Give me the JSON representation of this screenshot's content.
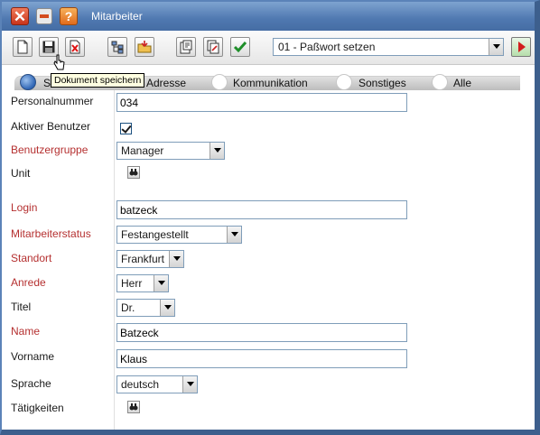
{
  "window": {
    "title": "Mitarbeiter"
  },
  "toolbar": {
    "action_select_value": "01 - Paßwort setzen",
    "tooltip": "Dokument speichern"
  },
  "tabs": [
    {
      "label": "S"
    },
    {
      "label": "Adresse"
    },
    {
      "label": "Kommunikation"
    },
    {
      "label": "Sonstiges"
    },
    {
      "label": "Alle"
    }
  ],
  "form": {
    "personalnummer": {
      "label": "Personalnummer",
      "value": "034"
    },
    "aktiver_benutzer": {
      "label": "Aktiver Benutzer",
      "checked": true
    },
    "benutzergruppe": {
      "label": "Benutzergruppe",
      "value": "Manager"
    },
    "unit": {
      "label": "Unit"
    },
    "login": {
      "label": "Login",
      "value": "batzeck"
    },
    "mitarbeiterstatus": {
      "label": "Mitarbeiterstatus",
      "value": "Festangestellt"
    },
    "standort": {
      "label": "Standort",
      "value": "Frankfurt"
    },
    "anrede": {
      "label": "Anrede",
      "value": "Herr"
    },
    "titel": {
      "label": "Titel",
      "value": "Dr."
    },
    "name": {
      "label": "Name",
      "value": "Batzeck"
    },
    "vorname": {
      "label": "Vorname",
      "value": "Klaus"
    },
    "sprache": {
      "label": "Sprache",
      "value": "deutsch"
    },
    "taetigkeiten": {
      "label": "Tätigkeiten"
    }
  },
  "colors": {
    "title_bar": "#4f78b0",
    "required_label": "#b53030",
    "input_border": "#7f9db9"
  }
}
